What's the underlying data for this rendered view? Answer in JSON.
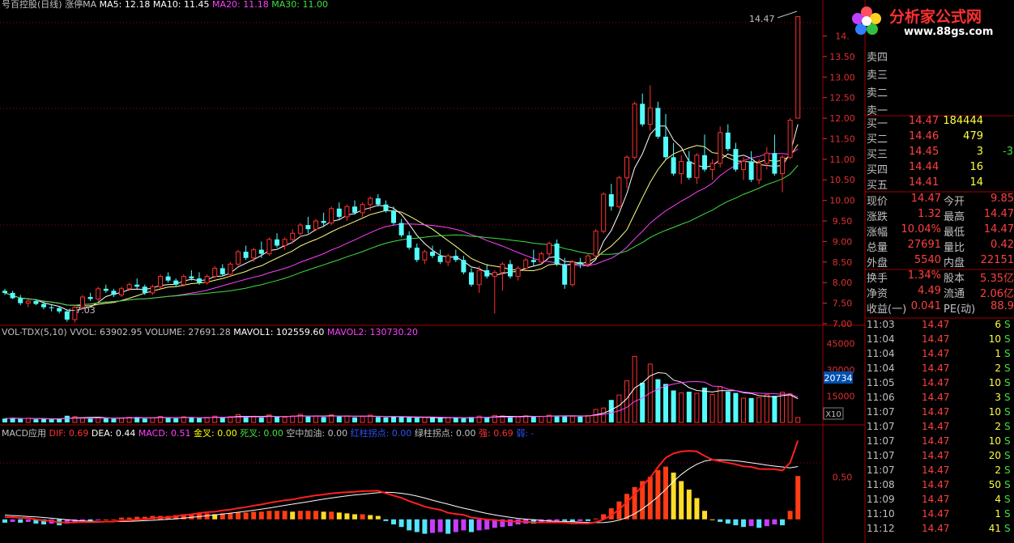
{
  "header": {
    "main_title": "号百控股(日线)",
    "main_indicator": "涨停MA",
    "ma5": "MA5: 12.18",
    "ma10": "MA10: 11.45",
    "ma20": "MA20: 11.18",
    "ma30": "MA30: 11.00",
    "vol_title": "VOL-TDX(5,10)",
    "vvol": "VVOL: 63902.95",
    "volume": "VOLUME: 27691.28",
    "mavol1": "MAVOL1: 102559.60",
    "mavol2": "MAVOL2: 130730.20",
    "macd_title": "MACD应用",
    "dif": "DIF: 0.69",
    "dea": "DEA: 0.44",
    "macd": "MACD: 0.51",
    "golden": "金叉: 0.00",
    "dead": "死叉: 0.00",
    "refuel": "空中加油: 0.00",
    "red_turn": "红柱拐点: 0.00",
    "green_turn": "绿柱拐点: 0.00",
    "strong": "强: 0.69",
    "weak": "弱: -"
  },
  "logo": {
    "text": "分析家公式网",
    "url": "www.88gs.com"
  },
  "price_axis": [
    "14.",
    "13.50",
    "13.00",
    "12.50",
    "12.00",
    "11.50",
    "11.00",
    "10.50",
    "10.00",
    "9.50",
    "9.00",
    "8.50",
    "8.00",
    "7.50",
    "7.00"
  ],
  "vol_axis": [
    "45000",
    "30000",
    "15000"
  ],
  "vol_badge": "20734",
  "vol_multiplier": "X10",
  "macd_axis": [
    "0.50"
  ],
  "annotations": {
    "high_label": "14.47",
    "low_label": "7.03"
  },
  "order_book": {
    "asks": [
      {
        "label": "卖四"
      },
      {
        "label": "卖三"
      },
      {
        "label": "卖二"
      },
      {
        "label": "卖一"
      }
    ],
    "bids": [
      {
        "label": "买一",
        "price": "14.47",
        "volume": "184444"
      },
      {
        "label": "买二",
        "price": "14.46",
        "volume": "479"
      },
      {
        "label": "买三",
        "price": "14.45",
        "volume": "3"
      },
      {
        "label": "买四",
        "price": "14.44",
        "volume": "16"
      },
      {
        "label": "买五",
        "price": "14.41",
        "volume": "14"
      }
    ],
    "bid3_extra": "-3"
  },
  "quote": [
    {
      "l1": "现价",
      "v1": "14.47",
      "l2": "今开",
      "v2": "9.85"
    },
    {
      "l1": "涨跌",
      "v1": "1.32",
      "l2": "最高",
      "v2": "14.47"
    },
    {
      "l1": "涨幅",
      "v1": "10.04%",
      "l2": "最低",
      "v2": "14.47"
    },
    {
      "l1": "总量",
      "v1": "27691",
      "l2": "量比",
      "v2": "0.42"
    },
    {
      "l1": "外盘",
      "v1": "5540",
      "l2": "内盘",
      "v2": "22151"
    },
    {
      "l1": "换手",
      "v1": "1.34%",
      "l2": "股本",
      "v2": "5.35亿"
    },
    {
      "l1": "净资",
      "v1": "4.49",
      "l2": "流通",
      "v2": "2.06亿"
    },
    {
      "l1": "收益(一)",
      "v1": "0.041",
      "l2": "PE(动)",
      "v2": "88.9"
    }
  ],
  "ticks": [
    {
      "time": "11:03",
      "price": "14.47",
      "vol": "6",
      "side": "S"
    },
    {
      "time": "11:04",
      "price": "14.47",
      "vol": "10",
      "side": "S"
    },
    {
      "time": "11:04",
      "price": "14.47",
      "vol": "1",
      "side": "S"
    },
    {
      "time": "11:04",
      "price": "14.47",
      "vol": "2",
      "side": "S"
    },
    {
      "time": "11:05",
      "price": "14.47",
      "vol": "10",
      "side": "S"
    },
    {
      "time": "11:06",
      "price": "14.47",
      "vol": "3",
      "side": "S"
    },
    {
      "time": "11:07",
      "price": "14.47",
      "vol": "10",
      "side": "S"
    },
    {
      "time": "11:07",
      "price": "14.47",
      "vol": "2",
      "side": "S"
    },
    {
      "time": "11:07",
      "price": "14.47",
      "vol": "10",
      "side": "S"
    },
    {
      "time": "11:07",
      "price": "14.47",
      "vol": "20",
      "side": "S"
    },
    {
      "time": "11:07",
      "price": "14.47",
      "vol": "2",
      "side": "S"
    },
    {
      "time": "11:08",
      "price": "14.47",
      "vol": "50",
      "side": "S"
    },
    {
      "time": "11:09",
      "price": "14.47",
      "vol": "4",
      "side": "S"
    },
    {
      "time": "11:10",
      "price": "14.47",
      "vol": "1",
      "side": "S"
    },
    {
      "time": "11:12",
      "price": "14.47",
      "vol": "41",
      "side": "S"
    }
  ],
  "chart_data": {
    "type": "candlestick",
    "price_ylim": [
      7.0,
      14.6
    ],
    "candles": [
      [
        7.8,
        7.85,
        7.7,
        7.75
      ],
      [
        7.75,
        7.8,
        7.6,
        7.62
      ],
      [
        7.62,
        7.7,
        7.45,
        7.5
      ],
      [
        7.5,
        7.6,
        7.4,
        7.55
      ],
      [
        7.55,
        7.6,
        7.45,
        7.48
      ],
      [
        7.48,
        7.55,
        7.35,
        7.4
      ],
      [
        7.4,
        7.45,
        7.3,
        7.38
      ],
      [
        7.38,
        7.42,
        7.25,
        7.3
      ],
      [
        7.3,
        7.35,
        7.05,
        7.1
      ],
      [
        7.1,
        7.45,
        7.03,
        7.4
      ],
      [
        7.4,
        7.7,
        7.35,
        7.65
      ],
      [
        7.65,
        7.75,
        7.55,
        7.6
      ],
      [
        7.6,
        7.9,
        7.55,
        7.85
      ],
      [
        7.85,
        7.95,
        7.75,
        7.8
      ],
      [
        7.8,
        7.85,
        7.65,
        7.7
      ],
      [
        7.7,
        7.9,
        7.65,
        7.85
      ],
      [
        7.85,
        8.0,
        7.8,
        7.95
      ],
      [
        7.95,
        8.1,
        7.85,
        7.9
      ],
      [
        7.9,
        7.95,
        7.7,
        7.75
      ],
      [
        7.75,
        7.95,
        7.7,
        7.9
      ],
      [
        7.9,
        8.2,
        7.85,
        8.15
      ],
      [
        8.15,
        8.25,
        8.0,
        8.05
      ],
      [
        8.05,
        8.1,
        7.9,
        7.95
      ],
      [
        7.95,
        8.2,
        7.9,
        8.15
      ],
      [
        8.15,
        8.3,
        8.05,
        8.1
      ],
      [
        8.1,
        8.25,
        7.95,
        8.0
      ],
      [
        8.0,
        8.2,
        7.95,
        8.15
      ],
      [
        8.15,
        8.4,
        8.1,
        8.35
      ],
      [
        8.35,
        8.45,
        8.15,
        8.2
      ],
      [
        8.2,
        8.5,
        8.15,
        8.45
      ],
      [
        8.45,
        8.8,
        8.4,
        8.75
      ],
      [
        8.75,
        8.9,
        8.55,
        8.6
      ],
      [
        8.6,
        8.85,
        8.5,
        8.8
      ],
      [
        8.8,
        9.0,
        8.6,
        8.7
      ],
      [
        8.7,
        9.1,
        8.65,
        9.05
      ],
      [
        9.05,
        9.2,
        8.85,
        8.9
      ],
      [
        8.9,
        9.1,
        8.8,
        9.05
      ],
      [
        9.05,
        9.3,
        8.95,
        9.2
      ],
      [
        9.2,
        9.45,
        9.1,
        9.4
      ],
      [
        9.4,
        9.6,
        9.2,
        9.3
      ],
      [
        9.3,
        9.55,
        9.25,
        9.5
      ],
      [
        9.5,
        9.7,
        9.35,
        9.45
      ],
      [
        9.45,
        9.85,
        9.4,
        9.8
      ],
      [
        9.8,
        9.95,
        9.55,
        9.6
      ],
      [
        9.6,
        9.9,
        9.5,
        9.85
      ],
      [
        9.85,
        10.0,
        9.65,
        9.7
      ],
      [
        9.7,
        9.95,
        9.6,
        9.9
      ],
      [
        9.9,
        10.1,
        9.75,
        10.05
      ],
      [
        10.05,
        10.15,
        9.85,
        9.9
      ],
      [
        9.9,
        10.0,
        9.7,
        9.75
      ],
      [
        9.75,
        9.85,
        9.4,
        9.45
      ],
      [
        9.45,
        9.55,
        9.1,
        9.15
      ],
      [
        9.15,
        9.25,
        8.8,
        8.85
      ],
      [
        8.85,
        8.95,
        8.5,
        8.55
      ],
      [
        8.55,
        8.8,
        8.45,
        8.75
      ],
      [
        8.75,
        8.9,
        8.6,
        8.65
      ],
      [
        8.65,
        8.8,
        8.45,
        8.5
      ],
      [
        8.5,
        8.7,
        8.4,
        8.65
      ],
      [
        8.65,
        8.8,
        8.5,
        8.55
      ],
      [
        8.55,
        8.65,
        8.2,
        8.25
      ],
      [
        8.25,
        8.35,
        7.9,
        7.95
      ],
      [
        7.95,
        8.4,
        7.75,
        8.3
      ],
      [
        8.3,
        8.45,
        8.1,
        8.15
      ],
      [
        8.15,
        8.3,
        7.25,
        8.25
      ],
      [
        8.25,
        8.5,
        7.8,
        8.45
      ],
      [
        8.45,
        8.55,
        8.1,
        8.15
      ],
      [
        8.15,
        8.4,
        8.05,
        8.35
      ],
      [
        8.35,
        8.6,
        8.3,
        8.55
      ],
      [
        8.55,
        8.8,
        8.4,
        8.5
      ],
      [
        8.5,
        8.75,
        8.45,
        8.7
      ],
      [
        8.7,
        9.0,
        8.6,
        8.95
      ],
      [
        8.95,
        9.05,
        8.4,
        8.45
      ],
      [
        8.45,
        8.6,
        7.85,
        7.95
      ],
      [
        7.95,
        8.55,
        7.9,
        8.5
      ],
      [
        8.5,
        8.6,
        8.35,
        8.45
      ],
      [
        8.45,
        8.7,
        8.4,
        8.65
      ],
      [
        8.65,
        9.3,
        8.6,
        9.25
      ],
      [
        9.25,
        10.2,
        9.2,
        10.15
      ],
      [
        10.15,
        10.4,
        9.75,
        9.85
      ],
      [
        9.85,
        10.6,
        9.8,
        10.55
      ],
      [
        10.55,
        11.1,
        10.3,
        11.05
      ],
      [
        11.05,
        12.4,
        11.0,
        12.35
      ],
      [
        12.35,
        12.6,
        11.8,
        11.85
      ],
      [
        11.85,
        12.8,
        11.7,
        12.25
      ],
      [
        12.25,
        12.4,
        11.5,
        11.55
      ],
      [
        11.55,
        12.1,
        11.0,
        11.05
      ],
      [
        11.05,
        11.4,
        10.6,
        10.65
      ],
      [
        10.65,
        11.1,
        10.4,
        10.95
      ],
      [
        10.95,
        11.2,
        10.5,
        10.55
      ],
      [
        10.55,
        11.15,
        10.4,
        11.1
      ],
      [
        11.1,
        11.6,
        10.7,
        10.75
      ],
      [
        10.75,
        11.0,
        10.5,
        10.9
      ],
      [
        10.9,
        11.8,
        10.8,
        11.65
      ],
      [
        11.65,
        11.85,
        11.2,
        11.25
      ],
      [
        11.25,
        11.4,
        10.7,
        10.75
      ],
      [
        10.75,
        11.05,
        10.5,
        10.95
      ],
      [
        10.95,
        11.2,
        10.45,
        10.5
      ],
      [
        10.5,
        11.0,
        10.4,
        10.9
      ],
      [
        10.9,
        11.3,
        10.75,
        11.15
      ],
      [
        11.15,
        11.6,
        10.6,
        10.65
      ],
      [
        10.65,
        11.1,
        10.2,
        11.05
      ],
      [
        11.05,
        12.0,
        11.0,
        11.95
      ],
      [
        12.0,
        14.47,
        12.0,
        14.47
      ]
    ],
    "volume": [
      2200,
      2600,
      2100,
      2400,
      1800,
      2000,
      1700,
      2300,
      3800,
      3300,
      2600,
      2200,
      2900,
      2400,
      2100,
      2600,
      2900,
      3100,
      2200,
      2500,
      3400,
      2700,
      2300,
      3200,
      2600,
      2400,
      2900,
      3600,
      2700,
      3300,
      4400,
      3100,
      3500,
      2800,
      4300,
      3200,
      3000,
      3700,
      4600,
      3300,
      3600,
      3100,
      4300,
      3400,
      3700,
      2900,
      3400,
      4200,
      3100,
      2800,
      3300,
      3000,
      2700,
      2600,
      2900,
      2700,
      2500,
      2800,
      2600,
      2300,
      3100,
      3600,
      2900,
      4000,
      3700,
      3100,
      3200,
      3700,
      3500,
      3500,
      4100,
      3700,
      3900,
      3400,
      3400,
      3900,
      7400,
      8200,
      12800,
      15600,
      23700,
      37600,
      22600,
      33200,
      24600,
      21900,
      18200,
      16800,
      17500,
      16600,
      19800,
      15900,
      20400,
      17600,
      16800,
      13800,
      13900,
      14200,
      15800,
      15100,
      17200,
      16300,
      2769
    ],
    "macd_ylim": [
      -0.25,
      0.95
    ],
    "macd": [
      -0.04,
      -0.03,
      -0.04,
      -0.03,
      -0.05,
      -0.06,
      -0.05,
      -0.07,
      -0.05,
      -0.04,
      -0.02,
      -0.02,
      -0.01,
      0.0,
      0.0,
      0.02,
      0.02,
      0.03,
      0.03,
      0.04,
      0.04,
      0.04,
      0.05,
      0.06,
      0.06,
      0.07,
      0.07,
      0.06,
      0.07,
      0.07,
      0.08,
      0.08,
      0.09,
      0.09,
      0.1,
      0.1,
      0.1,
      0.09,
      0.1,
      0.1,
      0.1,
      0.09,
      0.09,
      0.08,
      0.07,
      0.06,
      0.06,
      0.05,
      0.04,
      -0.02,
      -0.06,
      -0.09,
      -0.13,
      -0.15,
      -0.17,
      -0.16,
      -0.15,
      -0.17,
      -0.15,
      -0.13,
      -0.15,
      -0.13,
      -0.12,
      -0.1,
      -0.09,
      -0.08,
      -0.06,
      -0.05,
      -0.05,
      -0.04,
      -0.03,
      -0.02,
      -0.02,
      -0.03,
      -0.02,
      -0.02,
      0.01,
      0.06,
      0.13,
      0.21,
      0.3,
      0.38,
      0.45,
      0.5,
      0.58,
      0.62,
      0.55,
      0.45,
      0.35,
      0.25,
      0.1,
      0.0,
      -0.03,
      -0.05,
      -0.07,
      -0.09,
      -0.08,
      -0.1,
      -0.08,
      -0.06,
      -0.07,
      0.1,
      0.51
    ]
  }
}
